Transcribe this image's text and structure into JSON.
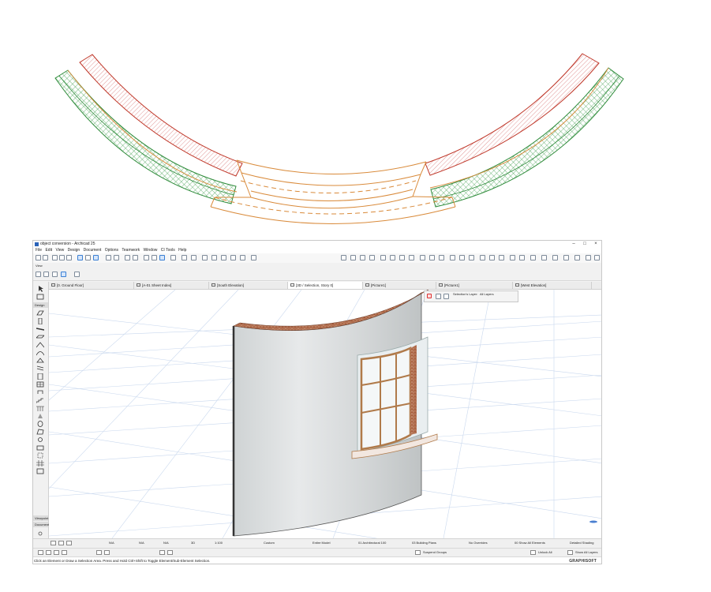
{
  "window": {
    "title": "object conversion - Archicad 25",
    "controls": [
      "–",
      "□",
      "×"
    ]
  },
  "menu": [
    "File",
    "Edit",
    "View",
    "Design",
    "Document",
    "Options",
    "Teamwork",
    "Window",
    "CI Tools",
    "Help"
  ],
  "viewbar_label": "View",
  "tabs": [
    {
      "label": "[0. Ground Floor]",
      "active": false
    },
    {
      "label": "[A-01 Sheet Index]",
      "active": false
    },
    {
      "label": "[South Elevation]",
      "active": false
    },
    {
      "label": "[3D / Selection, Story 0]",
      "active": true
    },
    {
      "label": "[Picture1]",
      "active": false
    },
    {
      "label": "[Picture1]",
      "active": false
    },
    {
      "label": "[West Elevation]",
      "active": false
    }
  ],
  "toolbox": {
    "sections": [
      "Design",
      "Viewpoint",
      "Document"
    ]
  },
  "infobox": {
    "title": "Selection's Layer:",
    "value": "All Layers"
  },
  "statusbar": {
    "zoom": "N/A",
    "angle": "N/A",
    "value3": "N/A",
    "view_type": "3D",
    "scale": "1:100",
    "structure": "Custom",
    "partial_structure": "Entire Model",
    "pen_set": "01 Architectural 100",
    "model_view": "03 Building Plans",
    "overrides": "No Overrides",
    "renovation": "00 Show All Elements",
    "shading": "Detailed Shading"
  },
  "bottombar": {
    "suspend_groups": "Suspend Groups",
    "unlock_all": "Unlock All",
    "show_all_layers": "Show All Layers"
  },
  "hint": "Click an Element or Draw a Selection Area. Press and Hold Ctrl+Shift to Toggle Element/Sub-Element Selection.",
  "brand": "GRAPHISOFT",
  "colors": {
    "wall_red": "#c0392b",
    "wall_green": "#2e8b3a",
    "window_orange": "#d98a3a",
    "selection_blue": "#3a7fd4"
  }
}
